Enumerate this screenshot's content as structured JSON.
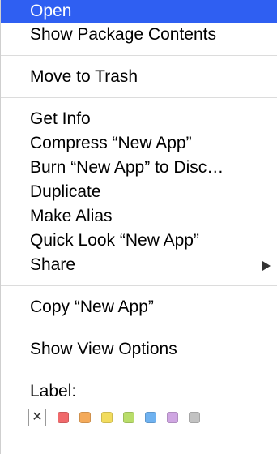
{
  "menu": {
    "group1": [
      {
        "name": "menu-item-open",
        "label": "Open",
        "highlighted": true
      },
      {
        "name": "menu-item-show-package-contents",
        "label": "Show Package Contents"
      }
    ],
    "group2": [
      {
        "name": "menu-item-move-to-trash",
        "label": "Move to Trash"
      }
    ],
    "group3": [
      {
        "name": "menu-item-get-info",
        "label": "Get Info"
      },
      {
        "name": "menu-item-compress",
        "label": "Compress “New App”"
      },
      {
        "name": "menu-item-burn",
        "label": "Burn “New App” to Disc…"
      },
      {
        "name": "menu-item-duplicate",
        "label": "Duplicate"
      },
      {
        "name": "menu-item-make-alias",
        "label": "Make Alias"
      },
      {
        "name": "menu-item-quick-look",
        "label": "Quick Look “New App”"
      },
      {
        "name": "menu-item-share",
        "label": "Share",
        "submenu": true
      }
    ],
    "group4": [
      {
        "name": "menu-item-copy",
        "label": "Copy “New App”"
      }
    ],
    "group5": [
      {
        "name": "menu-item-show-view-options",
        "label": "Show View Options"
      }
    ],
    "label_section": {
      "heading": "Label:",
      "none_glyph": "✕",
      "colors": [
        {
          "name": "label-red",
          "color": "#f0696b"
        },
        {
          "name": "label-orange",
          "color": "#f4aa5a"
        },
        {
          "name": "label-yellow",
          "color": "#f2dc5e"
        },
        {
          "name": "label-green",
          "color": "#b9dd6a"
        },
        {
          "name": "label-blue",
          "color": "#6fb2f0"
        },
        {
          "name": "label-purple",
          "color": "#cfa6e2"
        },
        {
          "name": "label-gray",
          "color": "#c2c2c2"
        }
      ]
    }
  },
  "colors": {
    "highlight": "#2f5ff2",
    "separator": "#dcdcdc"
  }
}
